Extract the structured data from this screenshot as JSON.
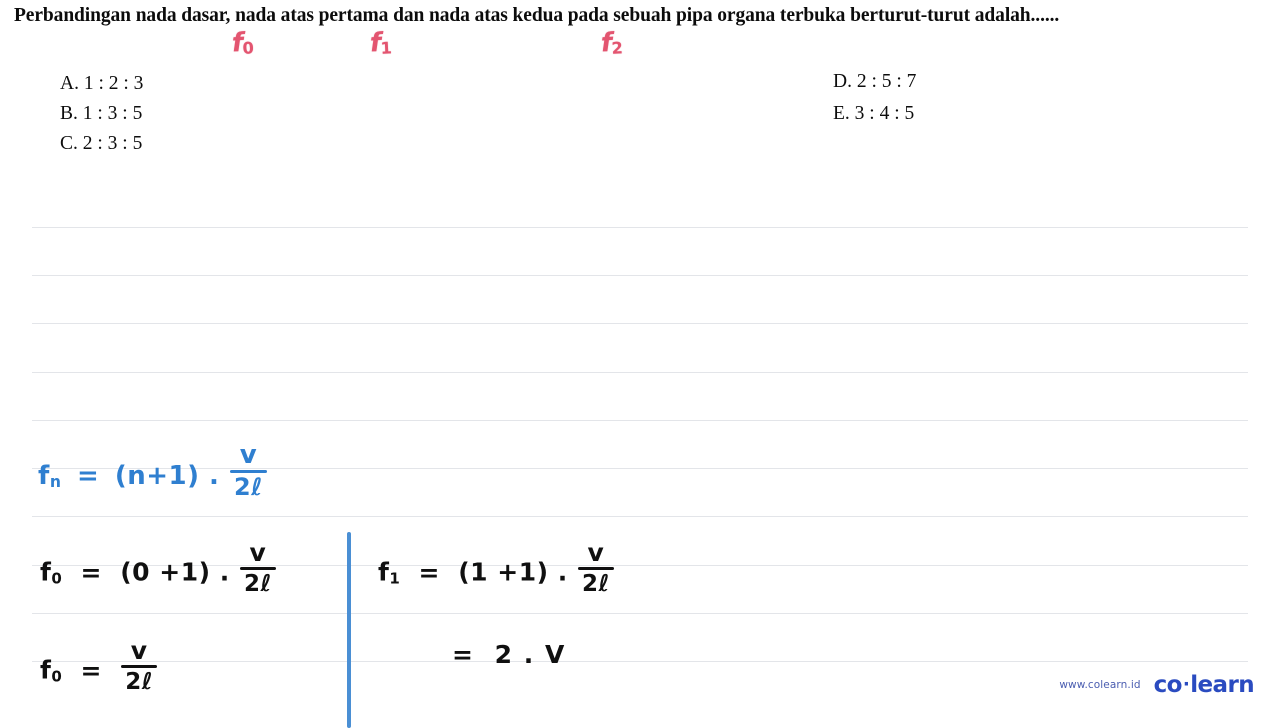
{
  "question": {
    "stem": "Perbandingan nada dasar, nada atas pertama dan nada atas kedua pada sebuah pipa organa terbuka berturut-turut adalah......",
    "annotations": [
      {
        "label": "f",
        "sub": "0",
        "color": "#e35570"
      },
      {
        "label": "f",
        "sub": "1",
        "color": "#e35570"
      },
      {
        "label": "f",
        "sub": "2",
        "color": "#e35570"
      }
    ],
    "options_left": [
      "A. 1 : 2 : 3",
      "B. 1 : 3 : 5",
      "C. 2 : 3 : 5"
    ],
    "options_right": [
      "D. 2 : 5 : 7",
      "E. 3 : 4 : 5"
    ]
  },
  "worksheet": {
    "ruled_line_color": "#e3e5e9",
    "divider_color": "#4a8fd4",
    "formula_general": {
      "color": "#2f7fd0",
      "lhs": "f",
      "lhs_sub": "n",
      "eq": "=",
      "factor": "(n+1) .",
      "numerator": "v",
      "denominator": "2ℓ"
    },
    "step_f0": {
      "color": "#101010",
      "lhs": "f",
      "lhs_sub": "0",
      "eq": "=",
      "factor": "(0 +1) .",
      "numerator": "v",
      "denominator": "2ℓ"
    },
    "result_f0": {
      "color": "#101010",
      "lhs": "f",
      "lhs_sub": "0",
      "eq": "=",
      "numerator": "v",
      "denominator": "2ℓ"
    },
    "step_f1": {
      "color": "#101010",
      "lhs": "f",
      "lhs_sub": "1",
      "eq": "=",
      "factor": "(1 +1) .",
      "numerator": "v",
      "denominator": "2ℓ"
    },
    "result_f1": {
      "color": "#101010",
      "eq": "=",
      "value": "2 .  V"
    }
  },
  "watermark": {
    "url": "www.colearn.id",
    "brand_first": "co",
    "brand_dot": "·",
    "brand_second": "learn",
    "color": "#2a4bc0"
  }
}
